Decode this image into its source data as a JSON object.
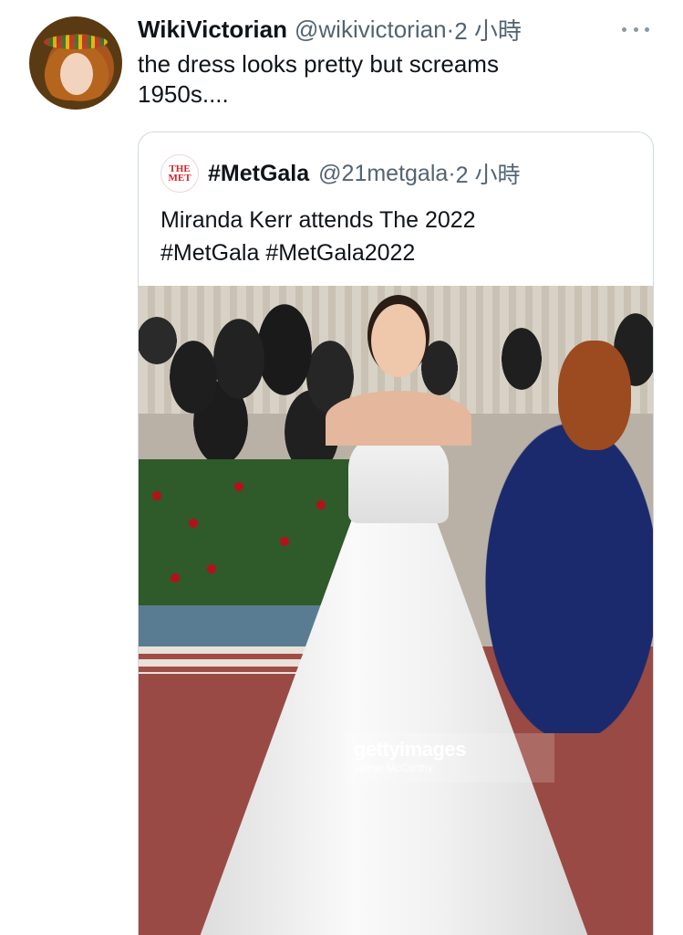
{
  "tweet": {
    "display_name": "WikiVictorian",
    "handle": "@wikivictorian",
    "separator": "·",
    "time": "2 小時",
    "text_line1": "the dress looks pretty but screams",
    "text_line2": "1950s...."
  },
  "quote": {
    "logo_line1": "THE",
    "logo_line2": "MET",
    "display_name": "#MetGala",
    "handle": "@21metgala",
    "separator": "·",
    "time": "2 小時",
    "text_line1": "Miranda Kerr attends The 2022",
    "text_line2": "#MetGala #MetGala2022",
    "photo": {
      "watermark_brand": "gettyimages",
      "watermark_credit": "Jamie McCarthy"
    }
  },
  "colors": {
    "text_primary": "#0f1419",
    "text_secondary": "#536471",
    "border": "#cfd9de",
    "met_red": "#d4242b"
  },
  "icons": {
    "more": "more-horizontal-icon"
  }
}
